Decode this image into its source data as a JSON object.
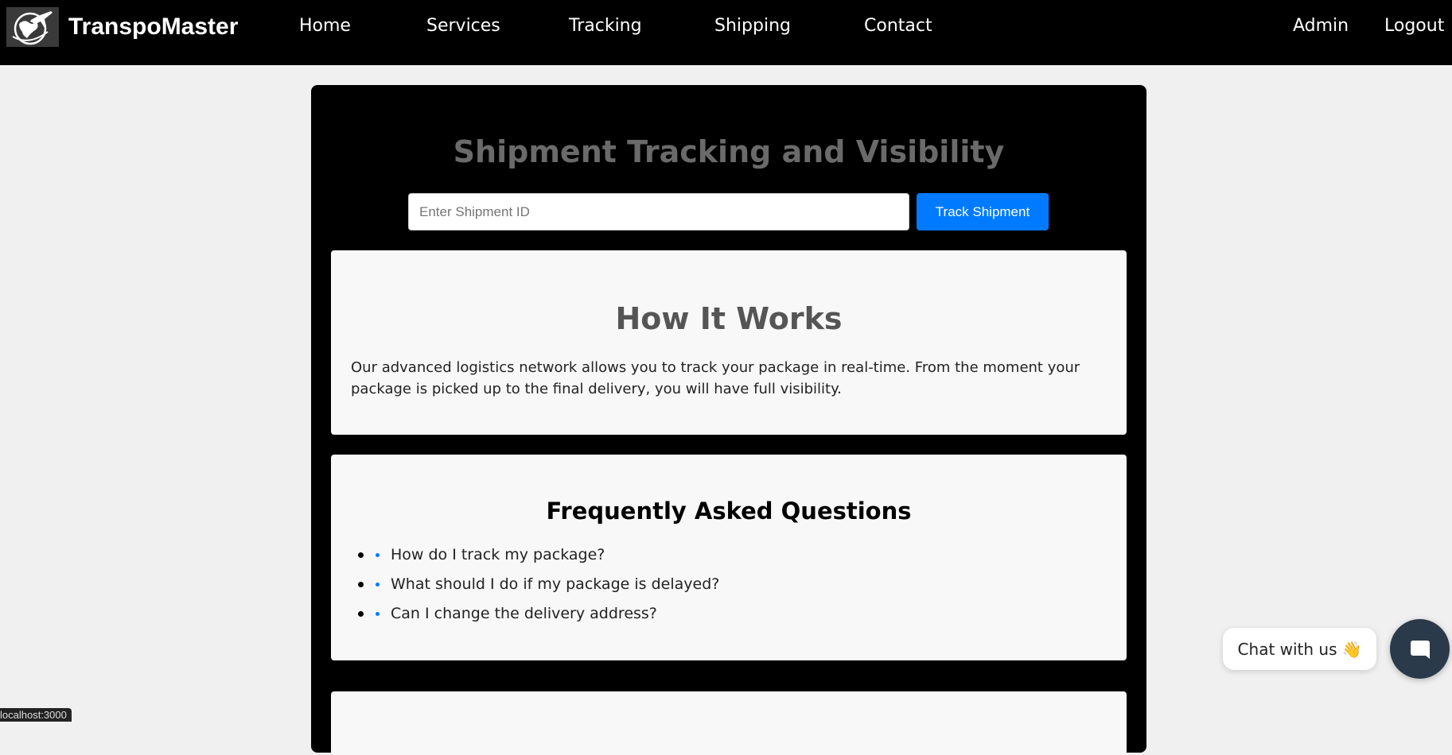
{
  "brand": {
    "name": "TranspoMaster",
    "logo_icon": "globe-airplane-icon"
  },
  "nav": {
    "home": "Home",
    "services": "Services",
    "tracking": "Tracking",
    "shipping": "Shipping",
    "contact": "Contact",
    "admin": "Admin",
    "logout": "Logout"
  },
  "tracking": {
    "title": "Shipment Tracking and Visibility",
    "input_placeholder": "Enter Shipment ID",
    "input_value": "",
    "button_label": "Track Shipment"
  },
  "how_it_works": {
    "title": "How It Works",
    "text": "Our advanced logistics network allows you to track your package in real-time. From the moment your package is picked up to the final delivery, you will have full visibility."
  },
  "faq": {
    "title": "Frequently Asked Questions",
    "items": [
      "How do I track my package?",
      "What should I do if my package is delayed?",
      "Can I change the delivery address?"
    ]
  },
  "chat": {
    "label": "Chat with us",
    "emoji": "👋",
    "button_icon": "chat-bubble-icon"
  },
  "status_bar": {
    "url": "localhost:3000"
  },
  "colors": {
    "accent": "#007bff",
    "navbar": "#000000",
    "panel": "#000000",
    "card": "#f8f8f8",
    "chat_button": "#2b3a4a"
  }
}
